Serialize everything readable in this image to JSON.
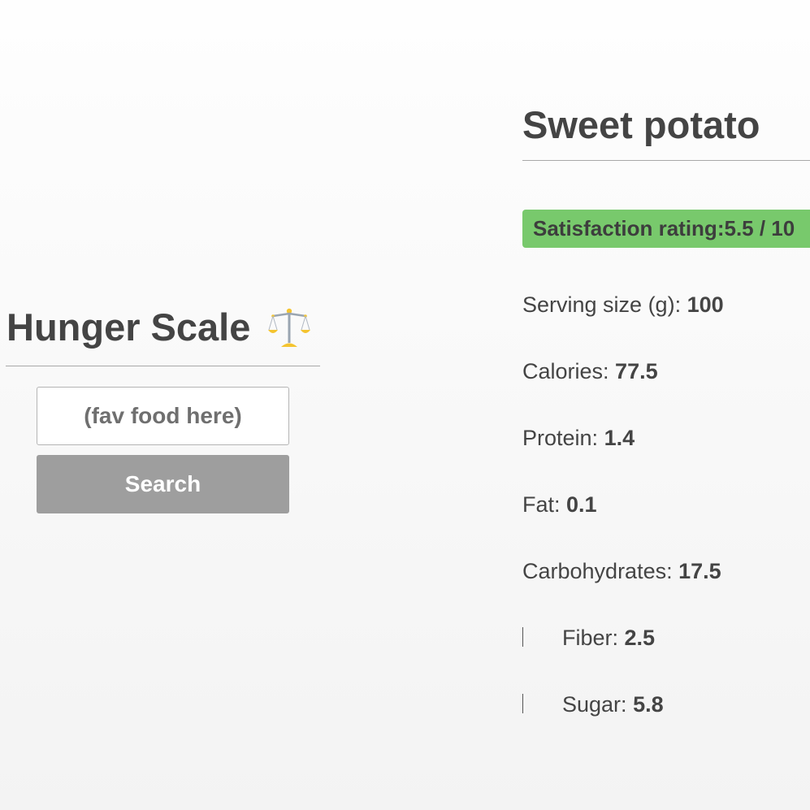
{
  "app": {
    "title": "Hunger Scale",
    "title_icon": "balance-scale-icon"
  },
  "search": {
    "placeholder": "(fav food here)",
    "value": "",
    "button_label": "Search"
  },
  "result": {
    "food_name": "Sweet potato",
    "rating": {
      "label": "Satisfaction rating:",
      "value": "5.5 / 10",
      "color": "#78c96c"
    },
    "nutrition": [
      {
        "label": "Serving size (g): ",
        "value": "100"
      },
      {
        "label": "Calories: ",
        "value": "77.5"
      },
      {
        "label": "Protein: ",
        "value": "1.4"
      },
      {
        "label": "Fat: ",
        "value": "0.1"
      },
      {
        "label": "Carbohydrates: ",
        "value": "17.5"
      },
      {
        "label": "Fiber: ",
        "value": "2.5"
      },
      {
        "label": "Sugar: ",
        "value": "5.8"
      }
    ]
  },
  "colors": {
    "text": "#444444",
    "button": "#9e9e9e",
    "rating_badge": "#78c96c"
  }
}
